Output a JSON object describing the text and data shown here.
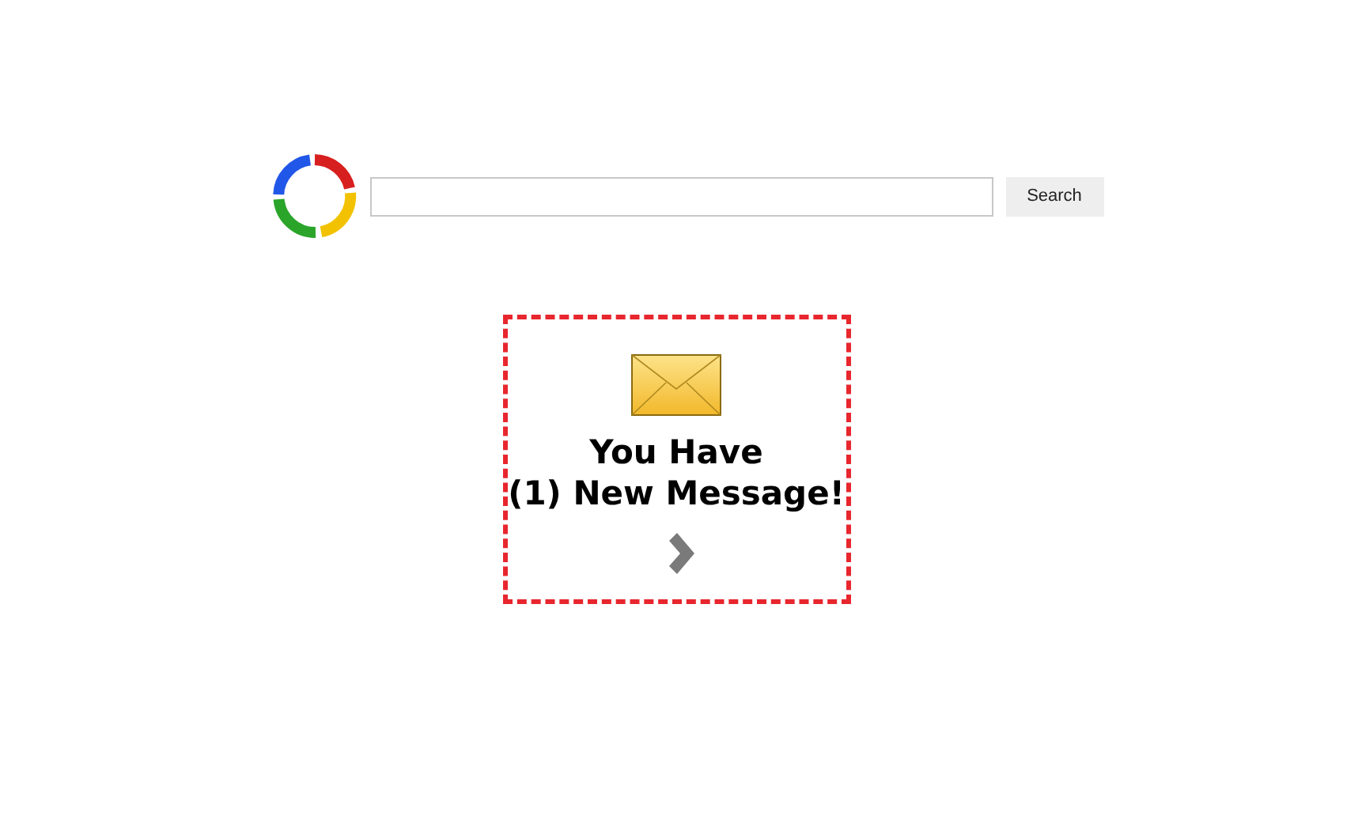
{
  "search": {
    "button": "Search"
  },
  "notification": {
    "lines": [
      "You Have",
      "(1) New Message!"
    ]
  }
}
